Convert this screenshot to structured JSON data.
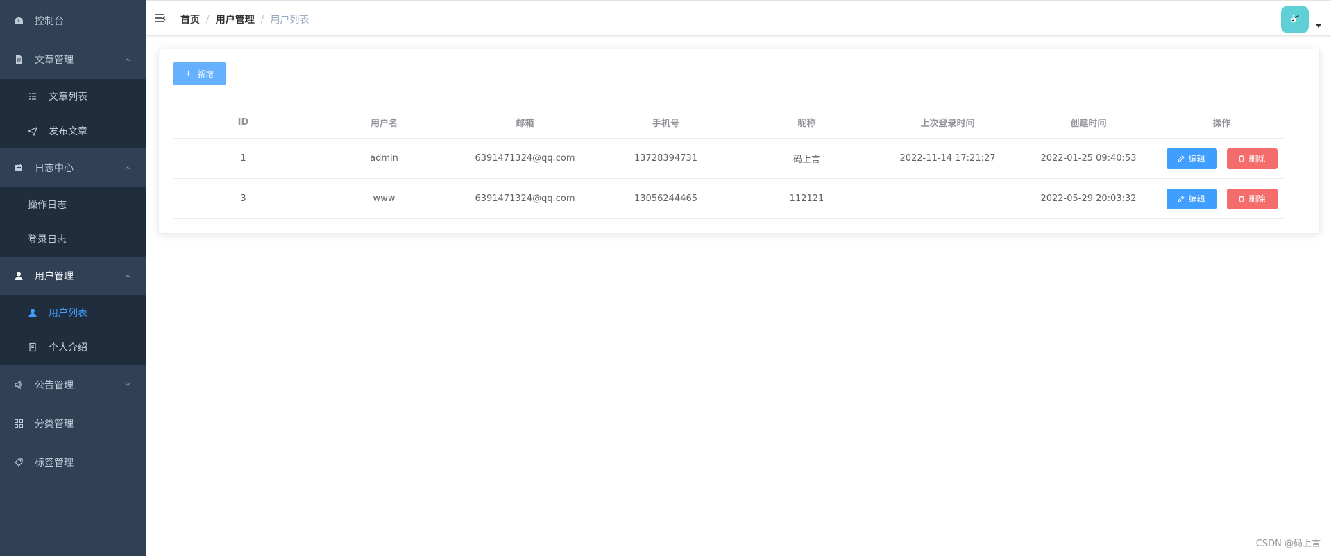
{
  "sidebar": {
    "items": [
      {
        "label": "控制台",
        "icon": "dashboard-icon"
      },
      {
        "label": "文章管理",
        "icon": "document-icon",
        "expanded": true
      },
      {
        "label": "文章列表",
        "icon": "list-icon"
      },
      {
        "label": "发布文章",
        "icon": "send-icon"
      },
      {
        "label": "日志中心",
        "icon": "calendar-icon",
        "expanded": true
      },
      {
        "label": "操作日志"
      },
      {
        "label": "登录日志"
      },
      {
        "label": "用户管理",
        "icon": "user-icon",
        "expanded": true
      },
      {
        "label": "用户列表",
        "icon": "user-icon",
        "active": true
      },
      {
        "label": "个人介绍",
        "icon": "notebook-icon"
      },
      {
        "label": "公告管理",
        "icon": "speaker-icon",
        "expanded": false
      },
      {
        "label": "分类管理",
        "icon": "grid-icon"
      },
      {
        "label": "标签管理",
        "icon": "tag-icon"
      }
    ]
  },
  "breadcrumb": [
    "首页",
    "用户管理",
    "用户列表"
  ],
  "toolbar": {
    "add_label": "新增"
  },
  "table": {
    "headers": [
      "ID",
      "用户名",
      "邮箱",
      "手机号",
      "昵称",
      "上次登录时间",
      "创建时间",
      "操作"
    ],
    "rows": [
      {
        "id": "1",
        "username": "admin",
        "email": "6391471324@qq.com",
        "phone": "13728394731",
        "nickname": "码上言",
        "last_login": "2022-11-14 17:21:27",
        "created": "2022-01-25 09:40:53"
      },
      {
        "id": "3",
        "username": "www",
        "email": "6391471324@qq.com",
        "phone": "13056244465",
        "nickname": "112121",
        "last_login": "",
        "created": "2022-05-29 20:03:32"
      }
    ],
    "edit_label": "编辑",
    "delete_label": "删除"
  },
  "watermark": "CSDN @码上言",
  "colors": {
    "sidebar_bg": "#304156",
    "submenu_bg": "#1f2d3d",
    "active": "#409eff",
    "danger": "#f56c6c"
  }
}
